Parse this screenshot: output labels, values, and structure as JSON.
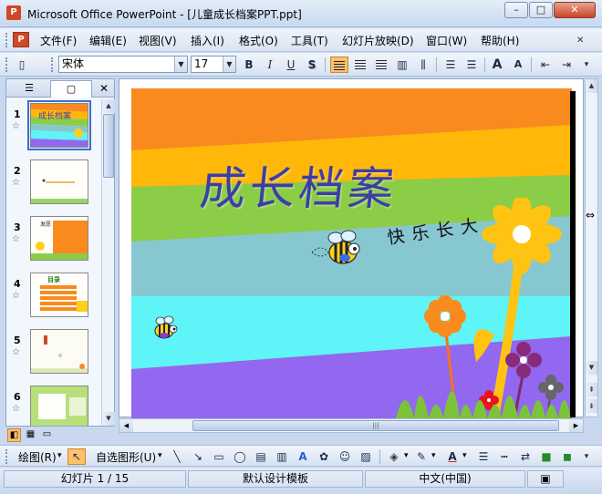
{
  "window": {
    "title": "Microsoft Office PowerPoint - [儿童成长档案PPT.ppt]",
    "app_icon": "P",
    "controls": {
      "minimize": "–",
      "maximize": "□",
      "close": "✕"
    }
  },
  "menu": {
    "items": [
      "文件(F)",
      "编辑(E)",
      "视图(V)",
      "插入(I)",
      "格式(O)",
      "工具(T)",
      "幻灯片放映(D)",
      "窗口(W)",
      "帮助(H)"
    ],
    "doc_close": "✕"
  },
  "format_toolbar": {
    "font": "宋体",
    "size": "17",
    "bold": "B",
    "italic": "I",
    "underline": "U",
    "shadow": "S",
    "increase_font": "A",
    "decrease_font": "A"
  },
  "left_pane": {
    "close_glyph": "✕",
    "slides": [
      {
        "number": "1",
        "star": "☆",
        "selected": true,
        "caption": "成长档案"
      },
      {
        "number": "2",
        "star": "☆",
        "selected": false,
        "caption": ""
      },
      {
        "number": "3",
        "star": "☆",
        "selected": false,
        "caption": "发愿"
      },
      {
        "number": "4",
        "star": "☆",
        "selected": false,
        "caption": "目录"
      },
      {
        "number": "5",
        "star": "☆",
        "selected": false,
        "caption": ""
      },
      {
        "number": "6",
        "star": "☆",
        "selected": false,
        "caption": ""
      }
    ]
  },
  "slide": {
    "title": "成长档案",
    "subtitle": "快乐长大",
    "stripe_colors": [
      "#f98a1e",
      "#ffb70a",
      "#8ccd48",
      "#87c7d0",
      "#5ef4f8",
      "#9168ef"
    ]
  },
  "draw_toolbar": {
    "draw_label": "绘图(R)",
    "autoshapes_label": "自选图形(U)"
  },
  "status": {
    "slide_info": "幻灯片 1 / 15",
    "template": "默认设计模板",
    "language": "中文(中国)"
  }
}
